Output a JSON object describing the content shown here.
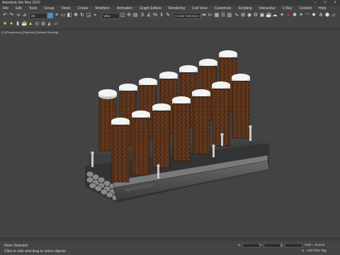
{
  "window": {
    "title": "Autodesk 3ds Max 2020"
  },
  "menubar": {
    "items": [
      "File",
      "Edit",
      "Tools",
      "Group",
      "Views",
      "Create",
      "Modifiers",
      "Animation",
      "Graph Editors",
      "Rendering",
      "Civil View",
      "Customize",
      "Scripting",
      "Interactive",
      "V-Ray",
      "Content",
      "Help"
    ]
  },
  "toolbar": {
    "selection_filter": "All",
    "view_dropdown": "View",
    "selection_set_placeholder": "Create Selection Se"
  },
  "viewport": {
    "label": "[+] [Perspective] [Standard] [Default Shading]"
  },
  "status": {
    "selection": "None Selected",
    "prompt": "Click or click-and-drag to select objects",
    "x_label": "X:",
    "y_label": "Y:",
    "z_label": "Z:",
    "grid": "Grid = 10,0cm",
    "add_time_tag": "Add Time Tag"
  },
  "colors": {
    "background": "#444444",
    "viewport": "#434343",
    "accent": "#3b8fd8"
  }
}
